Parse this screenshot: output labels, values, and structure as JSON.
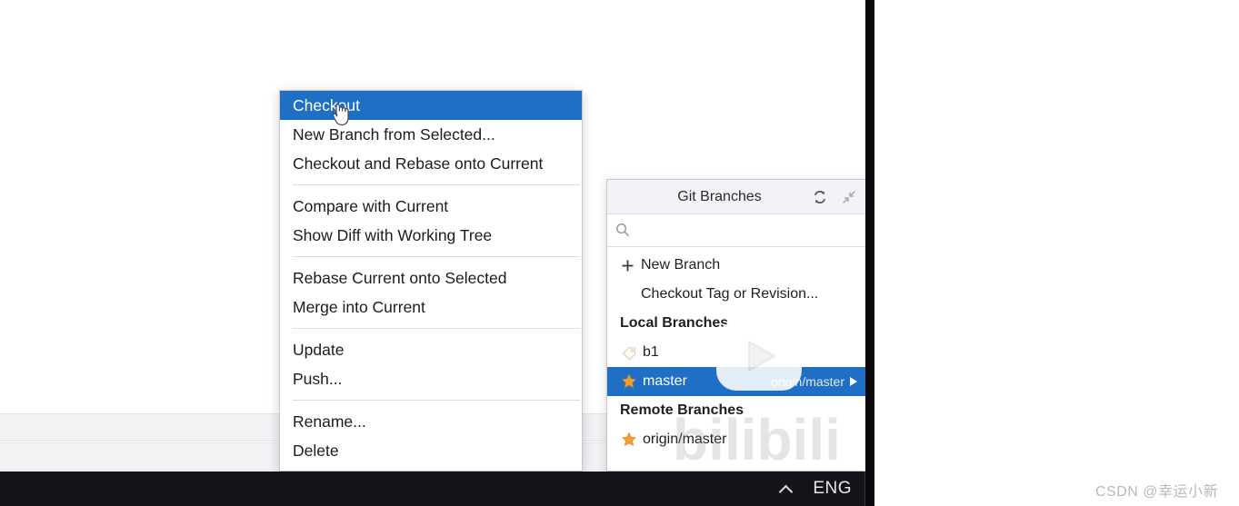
{
  "background": {
    "app_area_label": "ide-editor-background"
  },
  "context_menu": {
    "name": "git-branch-context-menu",
    "groups": [
      {
        "items": [
          {
            "label": "Checkout",
            "highlighted": true
          },
          {
            "label": "New Branch from Selected...",
            "highlighted": false
          },
          {
            "label": "Checkout and Rebase onto Current",
            "highlighted": false
          }
        ]
      },
      {
        "items": [
          {
            "label": "Compare with Current",
            "highlighted": false
          },
          {
            "label": "Show Diff with Working Tree",
            "highlighted": false
          }
        ]
      },
      {
        "items": [
          {
            "label": "Rebase Current onto Selected",
            "highlighted": false
          },
          {
            "label": "Merge into Current",
            "highlighted": false
          }
        ]
      },
      {
        "items": [
          {
            "label": "Update",
            "highlighted": false
          },
          {
            "label": "Push...",
            "highlighted": false
          }
        ]
      },
      {
        "items": [
          {
            "label": "Rename...",
            "highlighted": false
          },
          {
            "label": "Delete",
            "highlighted": false
          }
        ]
      }
    ],
    "highlight_color": "#1f6fc4"
  },
  "git_branches_popup": {
    "title": "Git Branches",
    "header_icons": [
      {
        "name": "refresh-icon",
        "title": "Refresh"
      },
      {
        "name": "collapse-icon",
        "title": "Collapse"
      }
    ],
    "search": {
      "value": "",
      "placeholder": ""
    },
    "actions": [
      {
        "label": "New Branch",
        "icon": "plus-icon"
      },
      {
        "label": "Checkout Tag or Revision...",
        "icon": "none"
      }
    ],
    "sections": [
      {
        "label": "Local Branches",
        "branches": [
          {
            "label": "b1",
            "icon": "tag-icon",
            "selected": false,
            "tracking": ""
          },
          {
            "label": "master",
            "icon": "star-icon",
            "selected": true,
            "tracking": "origin/master"
          }
        ]
      },
      {
        "label": "Remote Branches",
        "branches": [
          {
            "label": "origin/master",
            "icon": "star-icon",
            "selected": false,
            "tracking": ""
          }
        ]
      }
    ],
    "selected_color": "#1f6fc4",
    "star_color": "#f0a033"
  },
  "taskbar": {
    "chevron_icon": "chevron-up-icon",
    "language": "ENG"
  },
  "overlays": {
    "player_icon": "bilibili-play-button",
    "wordmark": "bilibili",
    "watermark": "CSDN @幸运小新"
  }
}
